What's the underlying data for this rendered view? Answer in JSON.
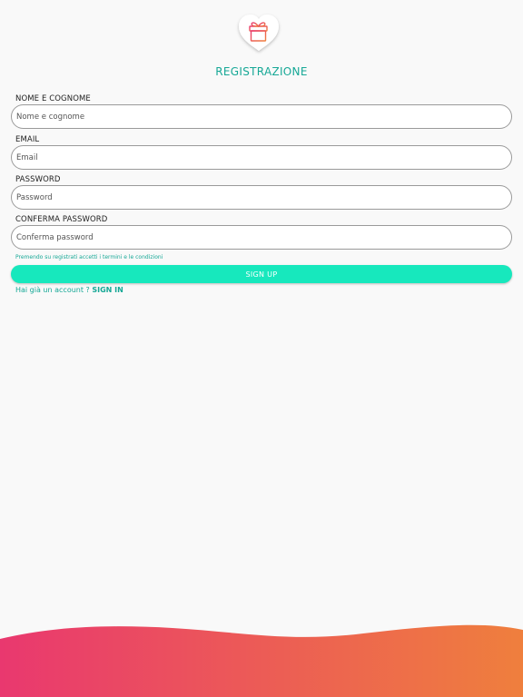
{
  "header": {
    "logo_icon": "gift-heart-icon",
    "title": "REGISTRAZIONE"
  },
  "form": {
    "fields": [
      {
        "label": "NOME E COGNOME",
        "placeholder": "Nome e cognome",
        "value": ""
      },
      {
        "label": "EMAIL",
        "placeholder": "Email",
        "value": ""
      },
      {
        "label": "PASSWORD",
        "placeholder": "Password",
        "value": ""
      },
      {
        "label": "CONFERMA PASSWORD",
        "placeholder": "Conferma password",
        "value": ""
      }
    ],
    "terms_text": "Premendo su registrati accetti i termini e le condizioni",
    "signup_label": "SIGN UP",
    "signin_prompt": "Hai già un account ?",
    "signin_link": "SIGN IN"
  },
  "colors": {
    "accent": "#16a896",
    "button": "#17e8bd",
    "wave_start": "#e9386f",
    "wave_end": "#ef7f3d"
  }
}
